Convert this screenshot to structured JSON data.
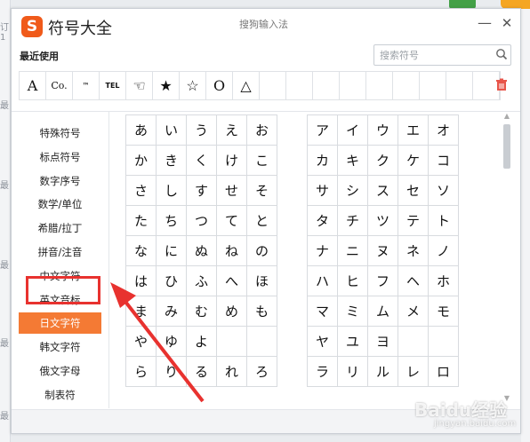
{
  "window": {
    "app_title": "符号大全",
    "center_title": "搜狗输入法",
    "minimize_label": "—",
    "close_label": "✕"
  },
  "recent": {
    "label": "最近使用",
    "items": [
      "A",
      "Co.",
      "™",
      "TEL",
      "☜",
      "★",
      "☆",
      "O",
      "△",
      "",
      "",
      "",
      "",
      "",
      "",
      "",
      "",
      ""
    ]
  },
  "search": {
    "placeholder": "搜索符号"
  },
  "categories": [
    {
      "label": "特殊符号",
      "active": false
    },
    {
      "label": "标点符号",
      "active": false
    },
    {
      "label": "数字序号",
      "active": false
    },
    {
      "label": "数学/单位",
      "active": false
    },
    {
      "label": "希腊/拉丁",
      "active": false
    },
    {
      "label": "拼音/注音",
      "active": false
    },
    {
      "label": "中文字符",
      "active": false
    },
    {
      "label": "英文音标",
      "active": false
    },
    {
      "label": "日文字符",
      "active": true
    },
    {
      "label": "韩文字符",
      "active": false
    },
    {
      "label": "俄文字母",
      "active": false
    },
    {
      "label": "制表符",
      "active": false
    }
  ],
  "hiragana": [
    [
      "あ",
      "い",
      "う",
      "え",
      "お"
    ],
    [
      "か",
      "き",
      "く",
      "け",
      "こ"
    ],
    [
      "さ",
      "し",
      "す",
      "せ",
      "そ"
    ],
    [
      "た",
      "ち",
      "つ",
      "て",
      "と"
    ],
    [
      "な",
      "に",
      "ぬ",
      "ね",
      "の"
    ],
    [
      "は",
      "ひ",
      "ふ",
      "へ",
      "ほ"
    ],
    [
      "ま",
      "み",
      "む",
      "め",
      "も"
    ],
    [
      "や",
      "ゆ",
      "よ",
      "",
      ""
    ],
    [
      "ら",
      "り",
      "る",
      "れ",
      "ろ"
    ]
  ],
  "katakana": [
    [
      "ア",
      "イ",
      "ウ",
      "エ",
      "オ"
    ],
    [
      "カ",
      "キ",
      "ク",
      "ケ",
      "コ"
    ],
    [
      "サ",
      "シ",
      "ス",
      "セ",
      "ソ"
    ],
    [
      "タ",
      "チ",
      "ツ",
      "テ",
      "ト"
    ],
    [
      "ナ",
      "ニ",
      "ヌ",
      "ネ",
      "ノ"
    ],
    [
      "ハ",
      "ヒ",
      "フ",
      "ヘ",
      "ホ"
    ],
    [
      "マ",
      "ミ",
      "ム",
      "メ",
      "モ"
    ],
    [
      "ヤ",
      "ユ",
      "ヨ",
      "",
      ""
    ],
    [
      "ラ",
      "リ",
      "ル",
      "レ",
      "ロ"
    ]
  ],
  "background": {
    "left_texts": [
      "订1",
      "最",
      "最",
      "最",
      "最",
      "最"
    ]
  },
  "watermark": {
    "main": "Baidu经验",
    "sub": "jingyan.baidu.com"
  },
  "colors": {
    "accent": "#f47a34",
    "logo": "#f05a1a",
    "highlight": "#e8322f"
  }
}
